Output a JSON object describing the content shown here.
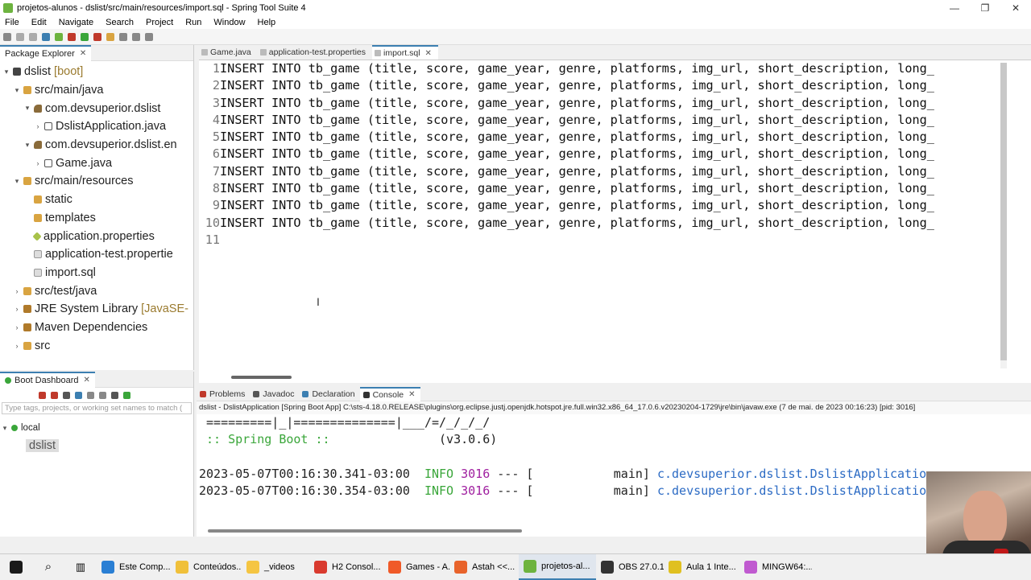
{
  "window": {
    "title": "projetos-alunos - dslist/src/main/resources/import.sql - Spring Tool Suite 4",
    "controls": [
      "—",
      "❐",
      "✕"
    ]
  },
  "menu": [
    "File",
    "Edit",
    "Navigate",
    "Search",
    "Project",
    "Run",
    "Window",
    "Help"
  ],
  "package_explorer": {
    "tab_label": "Package Explorer",
    "tree": [
      {
        "label": "dslist",
        "deco": "[boot]",
        "depth": 0,
        "twisty": "▾",
        "icon": "proj"
      },
      {
        "label": "src/main/java",
        "depth": 1,
        "twisty": "▾",
        "icon": "folder"
      },
      {
        "label": "com.devsuperior.dslist",
        "depth": 2,
        "twisty": "▾",
        "icon": "pkg"
      },
      {
        "label": "DslistApplication.java",
        "depth": 3,
        "twisty": "›",
        "icon": "java"
      },
      {
        "label": "com.devsuperior.dslist.en",
        "depth": 2,
        "twisty": "▾",
        "icon": "pkg"
      },
      {
        "label": "Game.java",
        "depth": 3,
        "twisty": "›",
        "icon": "java"
      },
      {
        "label": "src/main/resources",
        "depth": 1,
        "twisty": "▾",
        "icon": "folder"
      },
      {
        "label": "static",
        "depth": 2,
        "twisty": "",
        "icon": "folder"
      },
      {
        "label": "templates",
        "depth": 2,
        "twisty": "",
        "icon": "folder"
      },
      {
        "label": "application.properties",
        "depth": 2,
        "twisty": "",
        "icon": "prop"
      },
      {
        "label": "application-test.propertie",
        "depth": 2,
        "twisty": "",
        "icon": "file"
      },
      {
        "label": "import.sql",
        "depth": 2,
        "twisty": "",
        "icon": "file"
      },
      {
        "label": "src/test/java",
        "depth": 1,
        "twisty": "›",
        "icon": "folder"
      },
      {
        "label": "JRE System Library",
        "deco": "[JavaSE-",
        "depth": 1,
        "twisty": "›",
        "icon": "lib"
      },
      {
        "label": "Maven Dependencies",
        "depth": 1,
        "twisty": "›",
        "icon": "lib"
      },
      {
        "label": "src",
        "depth": 1,
        "twisty": "›",
        "icon": "folder"
      }
    ]
  },
  "editor": {
    "tabs": [
      {
        "label": "Game.java",
        "active": false
      },
      {
        "label": "application-test.properties",
        "active": false
      },
      {
        "label": "import.sql",
        "active": true
      }
    ],
    "lines": [
      {
        "n": "1",
        "text": "INSERT INTO tb_game (title, score, game_year, genre, platforms, img_url, short_description, long_"
      },
      {
        "n": "2",
        "text": "INSERT INTO tb_game (title, score, game_year, genre, platforms, img_url, short_description, long_"
      },
      {
        "n": "3",
        "text": "INSERT INTO tb_game (title, score, game_year, genre, platforms, img_url, short_description, long_"
      },
      {
        "n": "4",
        "text": "INSERT INTO tb_game (title, score, game_year, genre, platforms, img_url, short_description, long_"
      },
      {
        "n": "5",
        "text": "INSERT INTO tb_game (title, score, game_year, genre, platforms, img_url, short_description, long_"
      },
      {
        "n": "6",
        "text": "INSERT INTO tb_game (title, score, game_year, genre, platforms, img_url, short_description, long_"
      },
      {
        "n": "7",
        "text": "INSERT INTO tb_game (title, score, game_year, genre, platforms, img_url, short_description, long_"
      },
      {
        "n": "8",
        "text": "INSERT INTO tb_game (title, score, game_year, genre, platforms, img_url, short_description, long_"
      },
      {
        "n": "9",
        "text": "INSERT INTO tb_game (title, score, game_year, genre, platforms, img_url, short_description, long_"
      },
      {
        "n": "10",
        "text": "INSERT INTO tb_game (title, score, game_year, genre, platforms, img_url, short_description, long_"
      },
      {
        "n": "11",
        "text": ""
      }
    ]
  },
  "boot_dashboard": {
    "tab_label": "Boot Dashboard",
    "filter_placeholder": "Type tags, projects, or working set names to match (",
    "group": "local",
    "app": "dslist"
  },
  "console": {
    "tabs": [
      {
        "label": "Problems",
        "active": false
      },
      {
        "label": "Javadoc",
        "active": false
      },
      {
        "label": "Declaration",
        "active": false
      },
      {
        "label": "Console",
        "active": true
      }
    ],
    "process_line": "dslist - DslistApplication [Spring Boot App] C:\\sts-4.18.0.RELEASE\\plugins\\org.eclipse.justj.openjdk.hotspot.jre.full.win32.x86_64_17.0.6.v20230204-1729\\jre\\bin\\javaw.exe  (7 de mai. de 2023 00:16:23) [pid: 3016]",
    "banner_line": " =========|_|==============|___/=/_/_/_/",
    "spring_label": " :: Spring Boot ::",
    "spring_version": "               (v3.0.6)",
    "logs": [
      {
        "ts": "2023-05-07T00:16:30.341-03:00",
        "level": "INFO",
        "pid": "3016",
        "sep": " --- [",
        "thread": "           main]",
        "logger": " c.devsuperior.dslist.DslistApplicatio"
      },
      {
        "ts": "2023-05-07T00:16:30.354-03:00",
        "level": "INFO",
        "pid": "3016",
        "sep": " --- [",
        "thread": "           main]",
        "logger": " c.devsuperior.dslist.DslistApplicatio"
      }
    ]
  },
  "taskbar": [
    {
      "label": "Este Comp...",
      "color": "#2a7fd4",
      "active": false
    },
    {
      "label": "Conteúdos...",
      "color": "#f0c03a",
      "active": false
    },
    {
      "label": "_videos",
      "color": "#f5c542",
      "active": false
    },
    {
      "label": "H2 Consol...",
      "color": "#d93a2e",
      "active": false
    },
    {
      "label": "Games - A...",
      "color": "#f05a28",
      "active": false
    },
    {
      "label": "Astah <<...",
      "color": "#e8632b",
      "active": false
    },
    {
      "label": "projetos-al...",
      "color": "#6db33f",
      "active": true
    },
    {
      "label": "OBS 27.0.1...",
      "color": "#333333",
      "active": false
    },
    {
      "label": "Aula 1 Inte...",
      "color": "#e0c020",
      "active": false
    },
    {
      "label": "MINGW64:...",
      "color": "#c05ad0",
      "active": false
    }
  ]
}
